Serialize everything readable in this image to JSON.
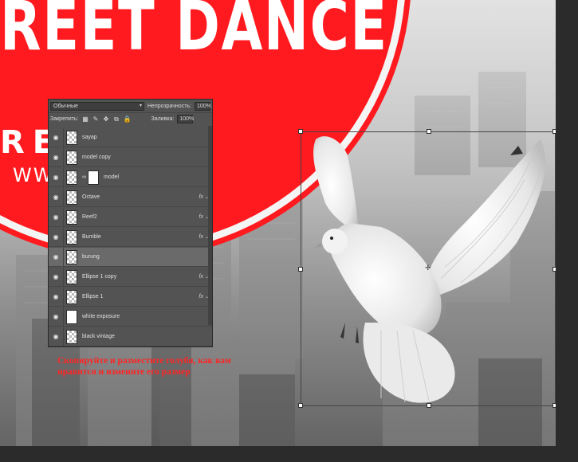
{
  "poster": {
    "title": "REET DANCE",
    "subtitle": "REG      W!",
    "url": "WW                OM"
  },
  "layers_panel": {
    "blend_mode": "Обычные",
    "opacity_label": "Непрозрачность:",
    "opacity_value": "100%",
    "lock_label": "Закрепить:",
    "fill_label": "Заливка:",
    "fill_value": "100%",
    "fx_label": "fx",
    "layers": [
      {
        "name": "sayap",
        "fx": false,
        "selected": false
      },
      {
        "name": "model copy",
        "fx": false,
        "selected": false
      },
      {
        "name": "model",
        "fx": false,
        "selected": false,
        "mask": true
      },
      {
        "name": "Octave",
        "fx": true,
        "selected": false
      },
      {
        "name": "Reef2",
        "fx": true,
        "selected": false
      },
      {
        "name": "Bumble",
        "fx": true,
        "selected": false
      },
      {
        "name": "burung",
        "fx": false,
        "selected": true
      },
      {
        "name": "Ellipse 1 copy",
        "fx": true,
        "selected": false
      },
      {
        "name": "Ellipse 1",
        "fx": true,
        "selected": false
      },
      {
        "name": "white exposure",
        "fx": false,
        "selected": false
      },
      {
        "name": "black vintage",
        "fx": false,
        "selected": false
      }
    ]
  },
  "caption": {
    "line1": "Скопируйте и разместите голубя, как вам",
    "line2": "нравится и измените его размер"
  },
  "colors": {
    "poster_red": "#ff1a1f",
    "caption_red": "#ff2424",
    "panel_bg": "#535353",
    "canvas_gray": "#b9b9b9"
  },
  "icons": {
    "visibility": "eye-icon",
    "lock_pixels": "checker-lock-icon",
    "lock_paint": "brush-lock-icon",
    "lock_move": "move-lock-icon",
    "lock_artboard": "artboard-lock-icon",
    "lock_all": "padlock-icon",
    "link": "chain-link-icon"
  }
}
